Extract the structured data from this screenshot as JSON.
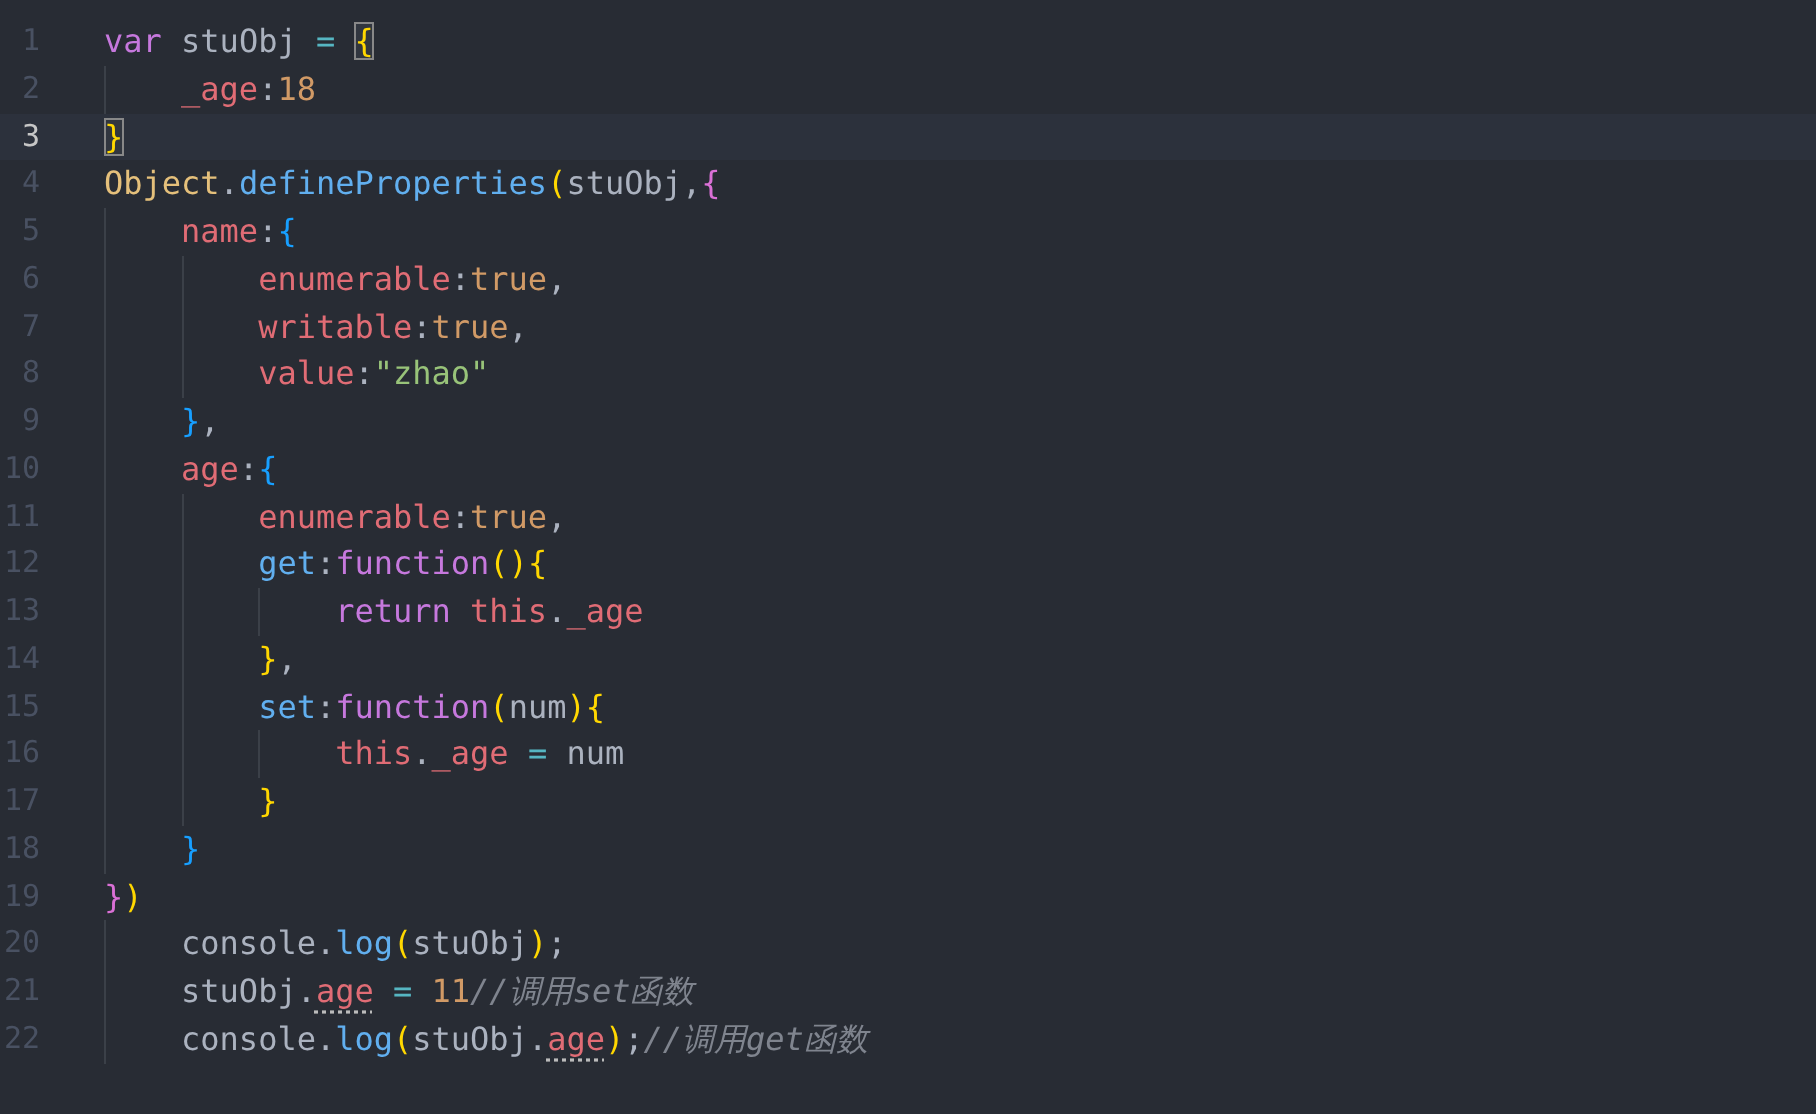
{
  "editor": {
    "lines": [
      {
        "number": "1",
        "current": false,
        "tokens": [
          {
            "kind": "kw",
            "text": "var"
          },
          {
            "kind": "plain",
            "text": " stuObj "
          },
          {
            "kind": "op",
            "text": "= "
          },
          {
            "kind": "match",
            "text": "{"
          }
        ]
      },
      {
        "number": "2",
        "current": false,
        "tokens": [
          {
            "kind": "prop",
            "text": "    _age"
          },
          {
            "kind": "punct",
            "text": ":"
          },
          {
            "kind": "num",
            "text": "18"
          }
        ]
      },
      {
        "number": "3",
        "current": true,
        "tokens": [
          {
            "kind": "match",
            "text": "}"
          }
        ]
      },
      {
        "number": "4",
        "current": false,
        "tokens": [
          {
            "kind": "cls",
            "text": "Object"
          },
          {
            "kind": "punct",
            "text": "."
          },
          {
            "kind": "fn",
            "text": "defineProperties"
          },
          {
            "kind": "b1",
            "text": "("
          },
          {
            "kind": "plain",
            "text": "stuObj,"
          },
          {
            "kind": "b2",
            "text": "{"
          }
        ]
      },
      {
        "number": "5",
        "current": false,
        "tokens": [
          {
            "kind": "prop",
            "text": "    name"
          },
          {
            "kind": "punct",
            "text": ":"
          },
          {
            "kind": "b3",
            "text": "{"
          }
        ]
      },
      {
        "number": "6",
        "current": false,
        "tokens": [
          {
            "kind": "prop",
            "text": "        enumerable"
          },
          {
            "kind": "punct",
            "text": ":"
          },
          {
            "kind": "num",
            "text": "true"
          },
          {
            "kind": "plain",
            "text": ","
          }
        ]
      },
      {
        "number": "7",
        "current": false,
        "tokens": [
          {
            "kind": "prop",
            "text": "        writable"
          },
          {
            "kind": "punct",
            "text": ":"
          },
          {
            "kind": "num",
            "text": "true"
          },
          {
            "kind": "plain",
            "text": ","
          }
        ]
      },
      {
        "number": "8",
        "current": false,
        "tokens": [
          {
            "kind": "prop",
            "text": "        value"
          },
          {
            "kind": "punct",
            "text": ":"
          },
          {
            "kind": "str",
            "text": "\"zhao\""
          }
        ]
      },
      {
        "number": "9",
        "current": false,
        "tokens": [
          {
            "kind": "b3",
            "text": "    }"
          },
          {
            "kind": "plain",
            "text": ","
          }
        ]
      },
      {
        "number": "10",
        "current": false,
        "tokens": [
          {
            "kind": "prop",
            "text": "    age"
          },
          {
            "kind": "punct",
            "text": ":"
          },
          {
            "kind": "b3",
            "text": "{"
          }
        ]
      },
      {
        "number": "11",
        "current": false,
        "tokens": [
          {
            "kind": "prop",
            "text": "        enumerable"
          },
          {
            "kind": "punct",
            "text": ":"
          },
          {
            "kind": "num",
            "text": "true"
          },
          {
            "kind": "plain",
            "text": ","
          }
        ]
      },
      {
        "number": "12",
        "current": false,
        "tokens": [
          {
            "kind": "fn",
            "text": "        get"
          },
          {
            "kind": "punct",
            "text": ":"
          },
          {
            "kind": "kw",
            "text": "function"
          },
          {
            "kind": "b1",
            "text": "(){"
          }
        ]
      },
      {
        "number": "13",
        "current": false,
        "tokens": [
          {
            "kind": "kw",
            "text": "            return "
          },
          {
            "kind": "prop",
            "text": "this"
          },
          {
            "kind": "punct",
            "text": "."
          },
          {
            "kind": "prop",
            "text": "_age"
          }
        ]
      },
      {
        "number": "14",
        "current": false,
        "tokens": [
          {
            "kind": "b1",
            "text": "        }"
          },
          {
            "kind": "plain",
            "text": ","
          }
        ]
      },
      {
        "number": "15",
        "current": false,
        "tokens": [
          {
            "kind": "fn",
            "text": "        set"
          },
          {
            "kind": "punct",
            "text": ":"
          },
          {
            "kind": "kw",
            "text": "function"
          },
          {
            "kind": "b1",
            "text": "("
          },
          {
            "kind": "plain",
            "text": "num"
          },
          {
            "kind": "b1",
            "text": "){"
          }
        ]
      },
      {
        "number": "16",
        "current": false,
        "tokens": [
          {
            "kind": "prop",
            "text": "            this"
          },
          {
            "kind": "punct",
            "text": "."
          },
          {
            "kind": "prop",
            "text": "_age "
          },
          {
            "kind": "op",
            "text": "="
          },
          {
            "kind": "plain",
            "text": " num"
          }
        ]
      },
      {
        "number": "17",
        "current": false,
        "tokens": [
          {
            "kind": "b1",
            "text": "        }"
          }
        ]
      },
      {
        "number": "18",
        "current": false,
        "tokens": [
          {
            "kind": "b3",
            "text": "    }"
          }
        ]
      },
      {
        "number": "19",
        "current": false,
        "tokens": [
          {
            "kind": "b2",
            "text": "}"
          },
          {
            "kind": "b1",
            "text": ")"
          }
        ]
      },
      {
        "number": "20",
        "current": false,
        "tokens": [
          {
            "kind": "plain",
            "text": "    console"
          },
          {
            "kind": "punct",
            "text": "."
          },
          {
            "kind": "fn",
            "text": "log"
          },
          {
            "kind": "b1",
            "text": "("
          },
          {
            "kind": "plain",
            "text": "stuObj"
          },
          {
            "kind": "b1",
            "text": ")"
          },
          {
            "kind": "plain",
            "text": ";"
          }
        ]
      },
      {
        "number": "21",
        "current": false,
        "tokens": [
          {
            "kind": "plain",
            "text": "    stuObj."
          },
          {
            "kind": "hint",
            "text": "age"
          },
          {
            "kind": "op",
            "text": " = "
          },
          {
            "kind": "num",
            "text": "11"
          },
          {
            "kind": "comment",
            "text": "//调用set函数"
          }
        ]
      },
      {
        "number": "22",
        "current": false,
        "tokens": [
          {
            "kind": "plain",
            "text": "    console."
          },
          {
            "kind": "fn",
            "text": "log"
          },
          {
            "kind": "b1",
            "text": "("
          },
          {
            "kind": "plain",
            "text": "stuObj."
          },
          {
            "kind": "hint",
            "text": "age"
          },
          {
            "kind": "b1",
            "text": ")"
          },
          {
            "kind": "plain",
            "text": ";"
          },
          {
            "kind": "comment",
            "text": "//调用get函数"
          }
        ]
      }
    ]
  }
}
